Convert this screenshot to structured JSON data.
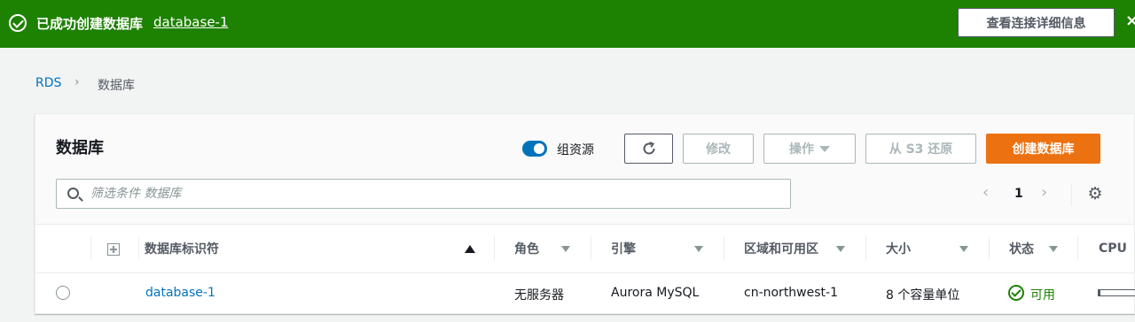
{
  "flash": {
    "message": "已成功创建数据库",
    "link": "database-1",
    "button": "查看连接详细信息",
    "close": "×"
  },
  "breadcrumb": {
    "root": "RDS",
    "separator": "›",
    "current": "数据库"
  },
  "panel": {
    "title": "数据库",
    "group_toggle_label": "组资源",
    "group_toggle_on": true,
    "buttons": {
      "modify": "修改",
      "actions": "操作",
      "restore": "从 S3 还原",
      "create": "创建数据库"
    },
    "search_placeholder": "筛选条件 数据库",
    "pagination": {
      "prev": "‹",
      "page": "1",
      "next": "›"
    }
  },
  "table": {
    "columns": [
      "数据库标识符",
      "角色",
      "引擎",
      "区域和可用区",
      "大小",
      "状态",
      "CPU"
    ],
    "rows": [
      {
        "identifier": "database-1",
        "role": "无服务器",
        "engine": "Aurora MySQL",
        "region": "cn-northwest-1",
        "size": "8 个容量单位",
        "status": "可用",
        "cpu_fraction": 0.03
      }
    ]
  },
  "colors": {
    "success": "#1d8102",
    "link": "#0073bb",
    "primary": "#ec7211"
  },
  "icons": [
    "check-circle-icon",
    "close-icon",
    "chevron-right-icon",
    "refresh-icon",
    "caret-down-icon",
    "search-icon",
    "chevron-left-icon",
    "gear-icon",
    "expand-icon",
    "sort-asc-icon",
    "sort-icon",
    "radio-icon"
  ]
}
